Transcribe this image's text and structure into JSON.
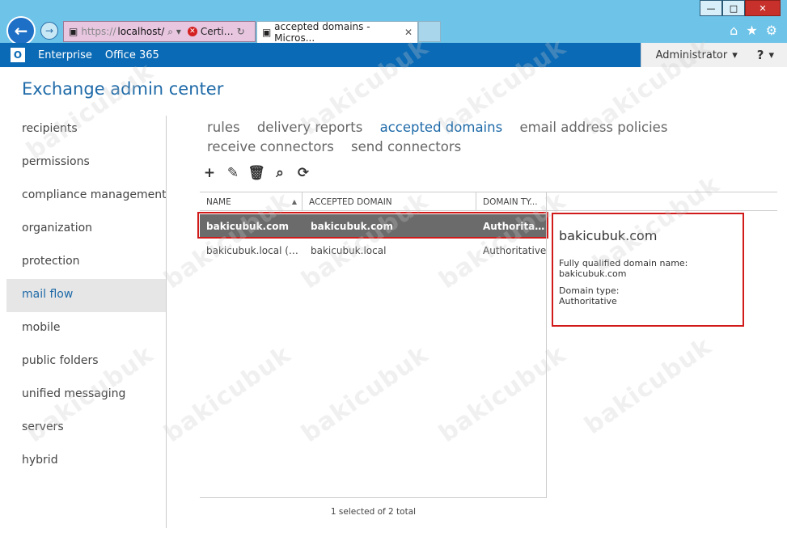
{
  "browser": {
    "window_buttons": {
      "minimize": "—",
      "maximize": "□",
      "close": "✕"
    },
    "address": {
      "protocol": "https://",
      "host": "localhost/",
      "search_glyph": "⌕ ▾",
      "cert_label": "Certi…",
      "refresh_glyph": "↻"
    },
    "tab_title": "accepted domains - Micros...",
    "tab_close": "✕",
    "right_icons": {
      "home": "⌂",
      "favorites": "★",
      "settings": "⚙"
    }
  },
  "topbar": {
    "logo": "O",
    "enterprise": "Enterprise",
    "office365": "Office 365",
    "user": "Administrator",
    "user_caret": "▾",
    "help": "?",
    "help_caret": "▾"
  },
  "app": {
    "title": "Exchange admin center"
  },
  "nav": {
    "items": [
      {
        "label": "recipients"
      },
      {
        "label": "permissions"
      },
      {
        "label": "compliance management"
      },
      {
        "label": "organization"
      },
      {
        "label": "protection"
      },
      {
        "label": "mail flow"
      },
      {
        "label": "mobile"
      },
      {
        "label": "public folders"
      },
      {
        "label": "unified messaging"
      },
      {
        "label": "servers"
      },
      {
        "label": "hybrid"
      }
    ],
    "active_index": 5
  },
  "tabs": {
    "items": [
      {
        "label": "rules"
      },
      {
        "label": "delivery reports"
      },
      {
        "label": "accepted domains"
      },
      {
        "label": "email address policies"
      },
      {
        "label": "receive connectors"
      },
      {
        "label": "send connectors"
      }
    ],
    "active_index": 2
  },
  "toolbar": {
    "add": "+",
    "edit": "✎",
    "delete": "🗑",
    "search": "⌕",
    "refresh": "⟳"
  },
  "grid": {
    "columns": [
      "NAME",
      "ACCEPTED DOMAIN",
      "DOMAIN TY..."
    ],
    "sort_arrow": "▲",
    "rows": [
      {
        "name": "bakicubuk.com",
        "domain": "bakicubuk.com",
        "type": "Authoritati..."
      },
      {
        "name": "bakicubuk.local (de...",
        "domain": "bakicubuk.local",
        "type": "Authoritative"
      }
    ],
    "status": "1 selected of 2 total"
  },
  "details": {
    "title": "bakicubuk.com",
    "fqdn_label": "Fully qualified domain name:",
    "fqdn_value": "bakicubuk.com",
    "type_label": "Domain type:",
    "type_value": "Authoritative"
  },
  "watermark": "bakicubuk",
  "colors": {
    "accent": "#1e6aa8",
    "office_bar": "#0a6ab5",
    "highlight": "#d11a1a",
    "selected_row": "#6b6b6b"
  }
}
